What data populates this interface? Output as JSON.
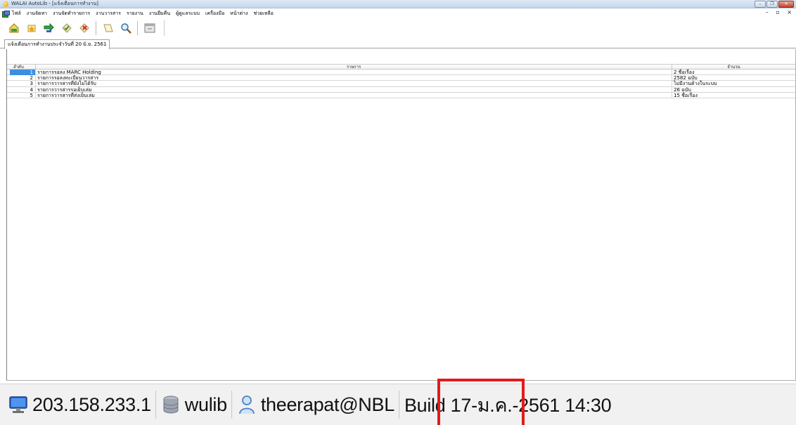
{
  "window": {
    "title": "WALAI AutoLib - [แจ้งเตือนการทำงาน]",
    "controls": [
      "minimize",
      "restore",
      "close"
    ]
  },
  "menu": {
    "items": [
      "ไฟล์",
      "งานจัดหา",
      "งานจัดทำรายการ",
      "งานวารสาร",
      "รายงาน",
      "งานยืมคืน",
      "ผู้ดูแลระบบ",
      "เครื่องมือ",
      "หน้าต่าง",
      "ช่วยเหลือ"
    ],
    "mdi_controls": "– ▫ ×"
  },
  "toolbar": {
    "icons": [
      "home-icon",
      "star-icon",
      "transfer-icon",
      "check-icon",
      "delete-icon",
      "document-icon",
      "search-icon",
      "window-icon"
    ]
  },
  "tab": {
    "label": "แจ้งเตือนการทำงานประจำวันที่ 20 มิ.ย. 2561"
  },
  "grid": {
    "columns": {
      "no": "ลำดับ",
      "item": "รายการ",
      "amount": "จำนวน"
    },
    "rows": [
      {
        "no": "1",
        "item": "รายการรอลง MARC Holding",
        "amount": "2 ชื่อเรื่อง",
        "selected": true
      },
      {
        "no": "2",
        "item": "รายการรอลงทะเบียนวารสาร",
        "amount": "2582 ฉบับ",
        "selected": false
      },
      {
        "no": "3",
        "item": "รายการวารสารที่ยังไม่ได้รับ",
        "amount": "ไม่มีงานค้างในระบบ",
        "selected": false
      },
      {
        "no": "4",
        "item": "รายการวารสารรอเย็บเล่ม",
        "amount": "26 ฉบับ",
        "selected": false
      },
      {
        "no": "5",
        "item": "รายการวารสารที่ส่งเย็บเล่ม",
        "amount": "15 ชื่อเรื่อง",
        "selected": false
      }
    ]
  },
  "status": {
    "ip": "203.158.233.1",
    "database": "wulib",
    "user": "theerapat@NBL",
    "build": "Build 17-ม.ค.-2561 14:30",
    "icons": [
      "monitor-icon",
      "database-icon",
      "user-icon"
    ]
  },
  "colors": {
    "selection": "#3b8fe0",
    "highlight_box": "#e31b1b"
  }
}
